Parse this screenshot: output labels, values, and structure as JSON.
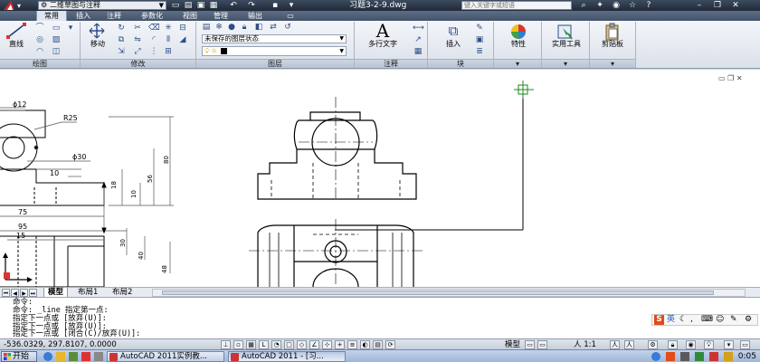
{
  "titlebar": {
    "workspace": "二维草图与注释",
    "document_title": "习题3-2-9.dwg",
    "search_placeholder": "键入关键字或短语"
  },
  "ribbon_tabs": [
    {
      "label": "常用",
      "active": true
    },
    {
      "label": "插入",
      "active": false
    },
    {
      "label": "注释",
      "active": false
    },
    {
      "label": "参数化",
      "active": false
    },
    {
      "label": "视图",
      "active": false
    },
    {
      "label": "管理",
      "active": false
    },
    {
      "label": "输出",
      "active": false
    }
  ],
  "ribbon": {
    "line_label": "直线",
    "move_label": "移动",
    "layer_state": "未保存的图层状态",
    "mtext_label": "多行文字",
    "insert_label": "插入",
    "properties_label": "特性",
    "utilities_label": "实用工具",
    "clipboard_label": "剪贴板",
    "panels": {
      "draw": "绘图",
      "modify": "修改",
      "layers": "图层",
      "annotation": "注释",
      "block": "块"
    }
  },
  "drawing": {
    "dims": {
      "d12": "ϕ12",
      "r25": "R25",
      "d30": "ϕ30",
      "d10": "10",
      "d75": "75",
      "d95": "95",
      "d15": "15",
      "d18": "18",
      "d56": "56",
      "d80": "80",
      "d10b": "10",
      "d30b": "30",
      "d40": "40",
      "d48": "48"
    }
  },
  "layout_tabs": [
    {
      "label": "模型",
      "active": true
    },
    {
      "label": "布局1",
      "active": false
    },
    {
      "label": "布局2",
      "active": false
    }
  ],
  "command_history": [
    "命令:",
    "命令: _line 指定第一点:",
    "指定下一点或 [放弃(U)]:",
    "指定下一点或 [放弃(U)]:",
    "指定下一点或 [闭合(C)/放弃(U)]:"
  ],
  "ime": {
    "lang": "英"
  },
  "statusbar": {
    "coords": "-536.0329, 297.8107, 0.0000",
    "model_label": "模型",
    "scale": "1:1"
  },
  "taskbar": {
    "start_label": "开始",
    "tasks": [
      {
        "label": "AutoCAD 2011实例教...",
        "active": false
      },
      {
        "label": "AutoCAD 2011 - [习...",
        "active": true
      }
    ],
    "clock": "0:05"
  },
  "colors": {
    "ribbon_bg": "#e6eaf0",
    "canvas": "#ffffff",
    "cursor": "#1b8a1b",
    "title_bar": "#2b3646"
  }
}
